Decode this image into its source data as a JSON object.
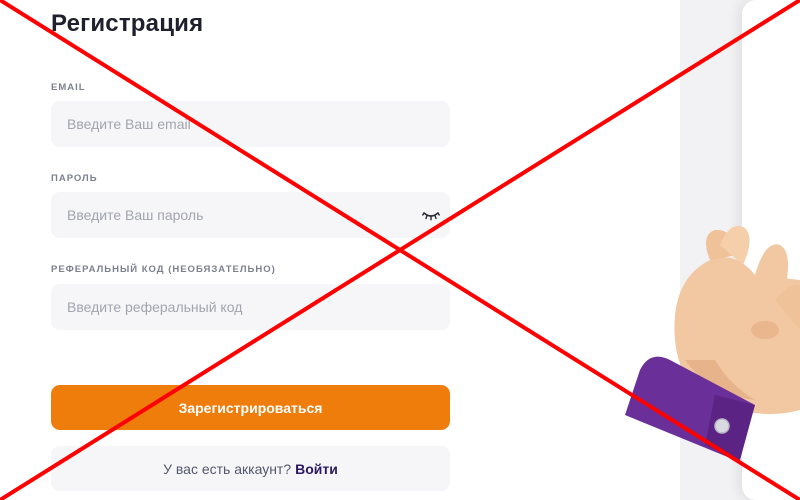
{
  "form": {
    "title": "Регистрация",
    "email": {
      "label": "EMAIL",
      "placeholder": "Введите Ваш email",
      "value": ""
    },
    "password": {
      "label": "ПАРОЛЬ",
      "placeholder": "Введите Ваш пароль",
      "value": ""
    },
    "referral": {
      "label": "РЕФЕРАЛЬНЫЙ КОД (НЕОБЯЗАТЕЛЬНО)",
      "placeholder": "Введите реферальный код",
      "value": ""
    },
    "submit_label": "Зарегистрироваться",
    "login_prompt": "У вас есть аккаунт?",
    "login_link": "Войти"
  },
  "icons": {
    "password_toggle": "eye-closed-icon",
    "illustration": "ok-hand-gesture"
  },
  "colors": {
    "accent": "#ee7d0c",
    "link": "#2c1960",
    "field_background": "#f6f6f8",
    "overlay_cross": "#ff0000",
    "sleeve": "#6b2f9a",
    "skin": "#f2c8a2"
  }
}
